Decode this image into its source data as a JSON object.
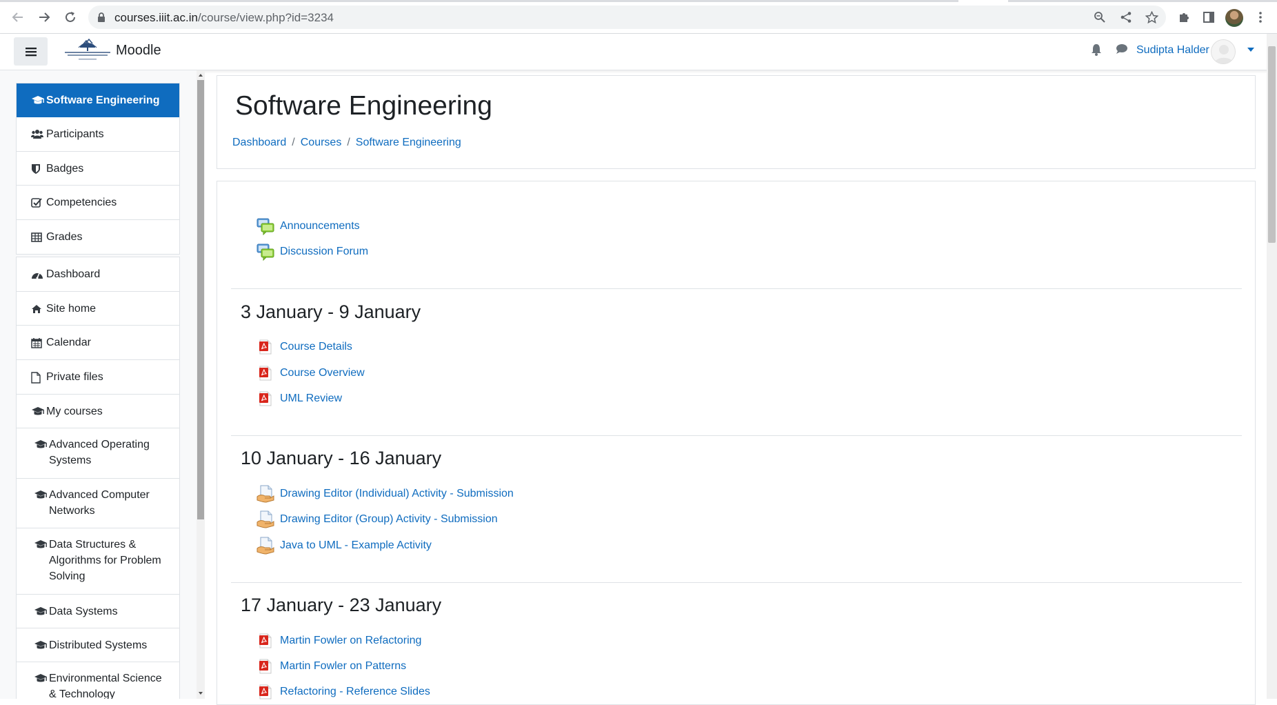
{
  "browser": {
    "url_host": "courses.iiit.ac.in",
    "url_path": "/course/view.php?id=3234"
  },
  "navbar": {
    "brand": "Moodle",
    "user_name": "Sudipta Halder"
  },
  "sidebar": {
    "course_items": [
      {
        "label": "Software Engineering",
        "icon": "graduation-cap-icon",
        "active": true
      },
      {
        "label": "Participants",
        "icon": "users-icon"
      },
      {
        "label": "Badges",
        "icon": "shield-icon"
      },
      {
        "label": "Competencies",
        "icon": "check-square-icon"
      },
      {
        "label": "Grades",
        "icon": "table-icon"
      }
    ],
    "site_items": [
      {
        "label": "Dashboard",
        "icon": "dashboard-icon"
      },
      {
        "label": "Site home",
        "icon": "home-icon"
      },
      {
        "label": "Calendar",
        "icon": "calendar-icon"
      },
      {
        "label": "Private files",
        "icon": "file-icon"
      },
      {
        "label": "My courses",
        "icon": "graduation-cap-icon"
      },
      {
        "label": "Advanced Operating Systems",
        "icon": "graduation-cap-icon"
      },
      {
        "label": "Advanced Computer Networks",
        "icon": "graduation-cap-icon"
      },
      {
        "label": "Data Structures & Algorithms for Problem Solving",
        "icon": "graduation-cap-icon"
      },
      {
        "label": "Data Systems",
        "icon": "graduation-cap-icon"
      },
      {
        "label": "Distributed Systems",
        "icon": "graduation-cap-icon"
      },
      {
        "label": "Environmental Science & Technology",
        "icon": "graduation-cap-icon"
      }
    ]
  },
  "header": {
    "title": "Software Engineering",
    "breadcrumb": [
      "Dashboard",
      "Courses",
      "Software Engineering"
    ]
  },
  "course": {
    "general": [
      {
        "label": "Announcements",
        "icon": "forum-icon"
      },
      {
        "label": "Discussion Forum",
        "icon": "forum-icon"
      }
    ],
    "sections": [
      {
        "title": "3 January - 9 January",
        "activities": [
          {
            "label": "Course Details",
            "icon": "pdf-icon"
          },
          {
            "label": "Course Overview",
            "icon": "pdf-icon"
          },
          {
            "label": "UML Review",
            "icon": "pdf-icon"
          }
        ]
      },
      {
        "title": "10 January - 16 January",
        "activities": [
          {
            "label": "Drawing Editor (Individual) Activity - Submission",
            "icon": "assignment-icon"
          },
          {
            "label": "Drawing Editor (Group) Activity - Submission",
            "icon": "assignment-icon"
          },
          {
            "label": "Java to UML - Example Activity",
            "icon": "assignment-icon"
          }
        ]
      },
      {
        "title": "17 January - 23 January",
        "activities": [
          {
            "label": "Martin Fowler on Refactoring",
            "icon": "pdf-icon"
          },
          {
            "label": "Martin Fowler on Patterns",
            "icon": "pdf-icon"
          },
          {
            "label": "Refactoring - Reference Slides",
            "icon": "pdf-icon"
          }
        ]
      }
    ]
  },
  "colors": {
    "link": "#0f6cbf",
    "active_nav_bg": "#0f6cbf",
    "text": "#1d2125"
  }
}
